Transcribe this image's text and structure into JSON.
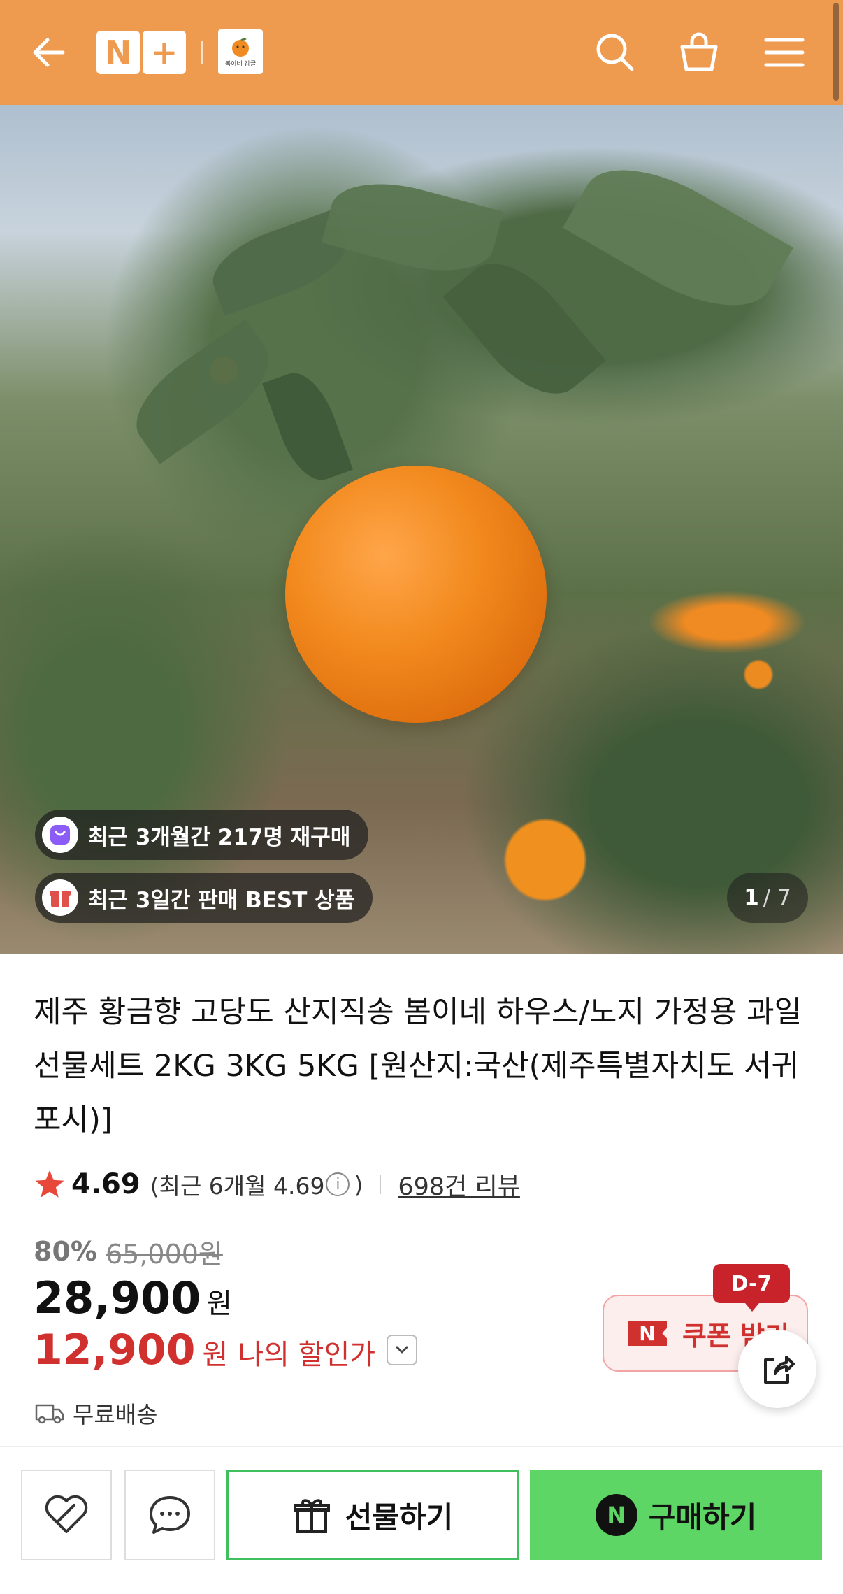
{
  "header": {
    "logo_left": "N",
    "logo_right": "+",
    "store_logo_text": "봄이네 감귤",
    "icons": [
      "back-arrow-icon",
      "search-icon",
      "shopping-bag-icon",
      "hamburger-menu-icon"
    ],
    "accent_color": "#ee9a4f"
  },
  "hero": {
    "badges": [
      {
        "text": "최근 3개월간 217명 재구매",
        "icon": "repurchase-bag-icon"
      },
      {
        "text": "최근 3일간 판매 BEST 상품",
        "icon": "gift-box-icon"
      }
    ],
    "pager_current": "1",
    "pager_total": "/ 7"
  },
  "product": {
    "title": "제주 황금향 고당도 산지직송 봄이네 하우스/노지 가정용 과일 선물세트 2KG 3KG 5KG [원산지:국산(제주특별자치도 서귀포시)]",
    "rating": "4.69",
    "recent_rating_prefix": "(최근 6개월 4.69",
    "recent_rating_suffix": ")",
    "review_count": "698건 리뷰",
    "discount_pct": "80%",
    "original_price": "65,000원",
    "price": "28,900",
    "price_unit": "원",
    "my_price": "12,900",
    "my_price_unit": "원",
    "my_price_label": "나의 할인가",
    "coupon_label": "쿠폰 받기",
    "coupon_logo": "N",
    "coupon_days": "D-7",
    "shipping": "무료배송",
    "discount_color": "#d0312e"
  },
  "bottom_bar": {
    "gift_label": "선물하기",
    "buy_label": "구매하기",
    "buy_logo": "N",
    "buy_color": "#5ed666"
  }
}
